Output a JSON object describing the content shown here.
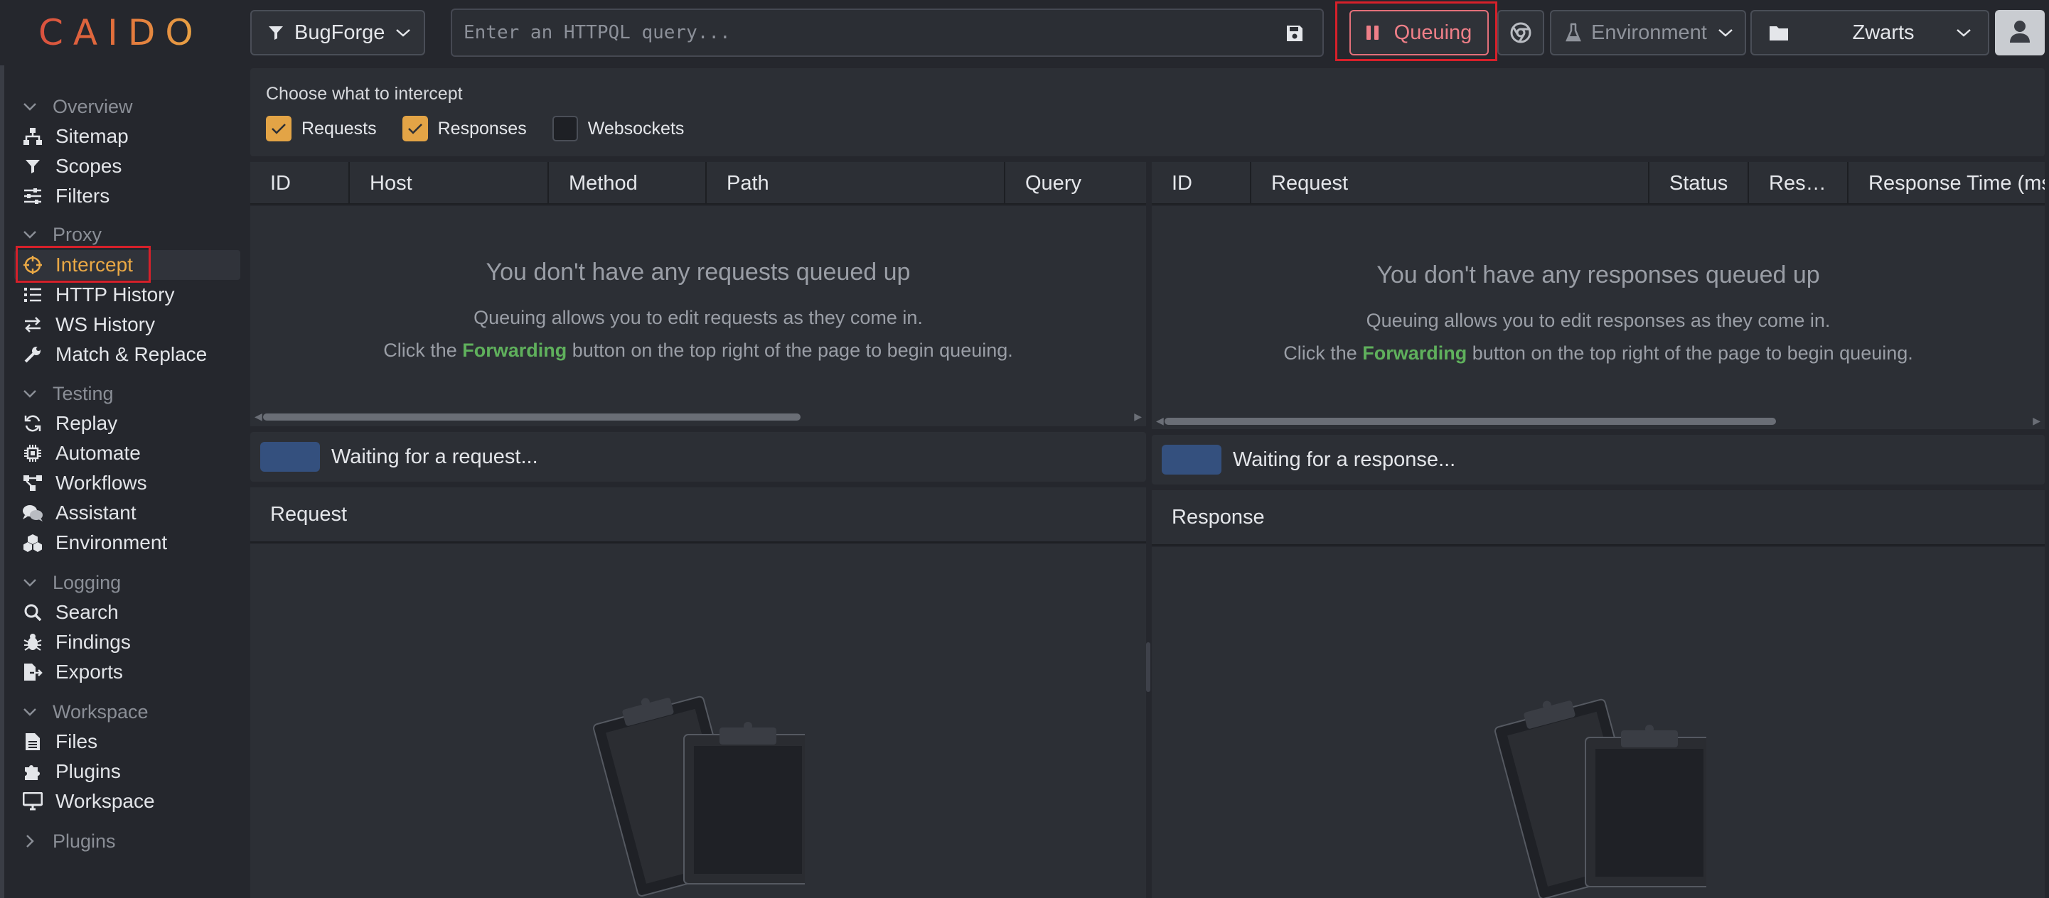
{
  "app": {
    "logo": "CAIDO"
  },
  "topbar": {
    "scope_label": "BugForge",
    "search_placeholder": "Enter an HTTPQL query...",
    "queue_label": "Queuing",
    "environment_label": "Environment",
    "project_label": "Zwarts"
  },
  "sidebar": {
    "groups": {
      "overview": "Overview",
      "proxy": "Proxy",
      "testing": "Testing",
      "logging": "Logging",
      "workspace": "Workspace",
      "plugins": "Plugins"
    },
    "items": {
      "sitemap": "Sitemap",
      "scopes": "Scopes",
      "filters": "Filters",
      "intercept": "Intercept",
      "http_history": "HTTP History",
      "ws_history": "WS History",
      "match_replace": "Match & Replace",
      "replay": "Replay",
      "automate": "Automate",
      "workflows": "Workflows",
      "assistant": "Assistant",
      "environment": "Environment",
      "search": "Search",
      "findings": "Findings",
      "exports": "Exports",
      "files": "Files",
      "plugins": "Plugins",
      "workspace": "Workspace"
    }
  },
  "intercept": {
    "choose_title": "Choose what to intercept",
    "options": [
      {
        "label": "Requests",
        "checked": true
      },
      {
        "label": "Responses",
        "checked": true
      },
      {
        "label": "Websockets",
        "checked": false
      }
    ],
    "requests_table": {
      "columns": [
        "ID",
        "Host",
        "Method",
        "Path",
        "Query"
      ],
      "empty_title": "You don't have any requests queued up",
      "empty_line1": "Queuing allows you to edit requests as they come in.",
      "empty_line2_pre": "Click the ",
      "empty_line2_bold": "Forwarding",
      "empty_line2_post": " button on the top right of the page to begin queuing."
    },
    "responses_table": {
      "columns": [
        "ID",
        "Request",
        "Status",
        "Res…",
        "Response Time (ms"
      ],
      "empty_title": "You don't have any responses queued up",
      "empty_line1": "Queuing allows you to edit responses as they come in.",
      "empty_line2_pre": "Click the ",
      "empty_line2_bold": "Forwarding",
      "empty_line2_post": " button on the top right of the page to begin queuing."
    },
    "waiting_request": "Waiting for a request...",
    "waiting_response": "Waiting for a response...",
    "request_editor_title": "Request",
    "response_editor_title": "Response"
  },
  "colors": {
    "accent": "#e9a845",
    "queue_red": "#ef7f88",
    "highlight_outline": "#d6202a",
    "forwarding_green": "#5fb05c"
  }
}
